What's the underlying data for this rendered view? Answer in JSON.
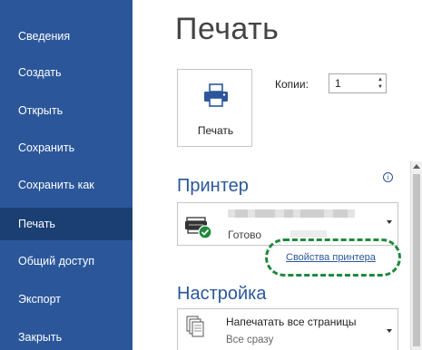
{
  "sidebar": {
    "items": [
      {
        "label": "Сведения"
      },
      {
        "label": "Создать"
      },
      {
        "label": "Открыть"
      },
      {
        "label": "Сохранить"
      },
      {
        "label": "Сохранить как"
      },
      {
        "label": "Печать"
      },
      {
        "label": "Общий доступ"
      },
      {
        "label": "Экспорт"
      },
      {
        "label": "Закрыть"
      }
    ],
    "active": "Печать"
  },
  "main": {
    "title": "Печать",
    "print_button": {
      "label": "Печать",
      "icon": "printer-icon"
    },
    "copies": {
      "label": "Копии:",
      "value": "1"
    },
    "printer": {
      "section_title": "Принтер",
      "info_icon": "i",
      "status": "Готово",
      "properties_link": "Свойства принтера"
    },
    "setup": {
      "section_title": "Настройка",
      "selection": "Напечатать все страницы",
      "sub": "Все сразу"
    }
  },
  "colors": {
    "sidebar_bg": "#2b579a",
    "sidebar_active": "#1b3f72",
    "accent": "#2b579a",
    "highlight": "#1e8a3c"
  }
}
